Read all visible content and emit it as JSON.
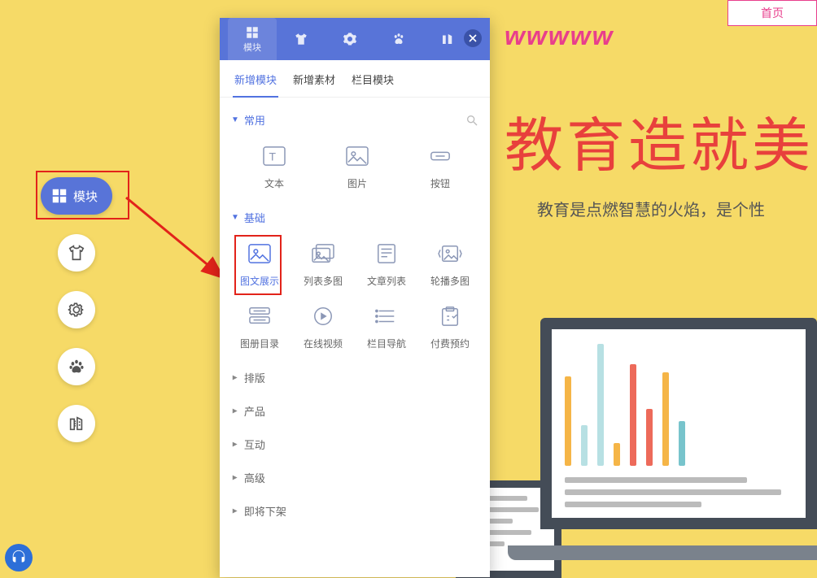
{
  "topnav": {
    "home": "首页"
  },
  "banner": "wwwww",
  "page": {
    "headline": "教育造就美",
    "subhead": "教育是点燃智慧的火焰，是个性"
  },
  "floatbar": {
    "modules": "模块"
  },
  "panel": {
    "head": {
      "modules": "模块"
    },
    "tabs": {
      "add_module": "新增模块",
      "add_asset": "新增素材",
      "column_module": "栏目模块"
    },
    "sections": {
      "common": {
        "title": "常用",
        "items": {
          "text": "文本",
          "image": "图片",
          "button": "按钮"
        }
      },
      "basic": {
        "title": "基础",
        "items": {
          "rich_image": "图文展示",
          "list_multi": "列表多图",
          "article_list": "文章列表",
          "carousel": "轮播多图",
          "album_dir": "图册目录",
          "video": "在线视频",
          "column_nav": "栏目导航",
          "paid_appt": "付费预约"
        }
      },
      "layout": {
        "title": "排版"
      },
      "product": {
        "title": "产品"
      },
      "interact": {
        "title": "互动"
      },
      "advanced": {
        "title": "高级"
      },
      "deprecated": {
        "title": "即将下架"
      }
    }
  }
}
